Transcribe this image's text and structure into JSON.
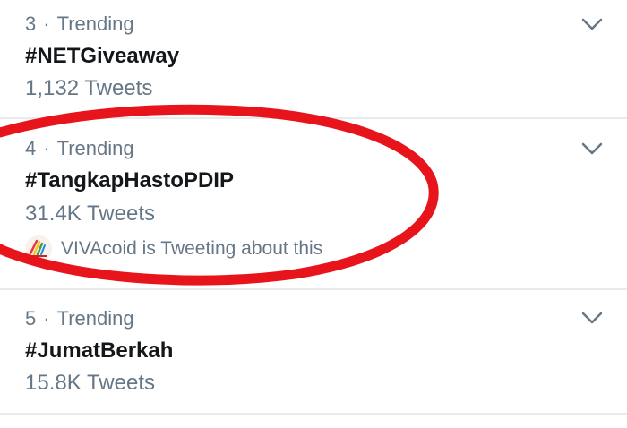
{
  "trends": [
    {
      "rank": "3",
      "separator": "·",
      "category": "Trending",
      "hashtag": "#NETGiveaway",
      "tweet_count": "1,132 Tweets"
    },
    {
      "rank": "4",
      "separator": "·",
      "category": "Trending",
      "hashtag": "#TangkapHastoPDIP",
      "tweet_count": "31.4K Tweets",
      "context": "VIVAcoid is Tweeting about this"
    },
    {
      "rank": "5",
      "separator": "·",
      "category": "Trending",
      "hashtag": "#JumatBerkah",
      "tweet_count": "15.8K Tweets"
    }
  ],
  "colors": {
    "muted_text": "#657786",
    "primary_text": "#14171a",
    "divider": "#e6ecf0",
    "annotation_circle": "#e8141c"
  },
  "icons": {
    "more_options": "chevron-down-icon",
    "context_avatar": "avatar"
  }
}
